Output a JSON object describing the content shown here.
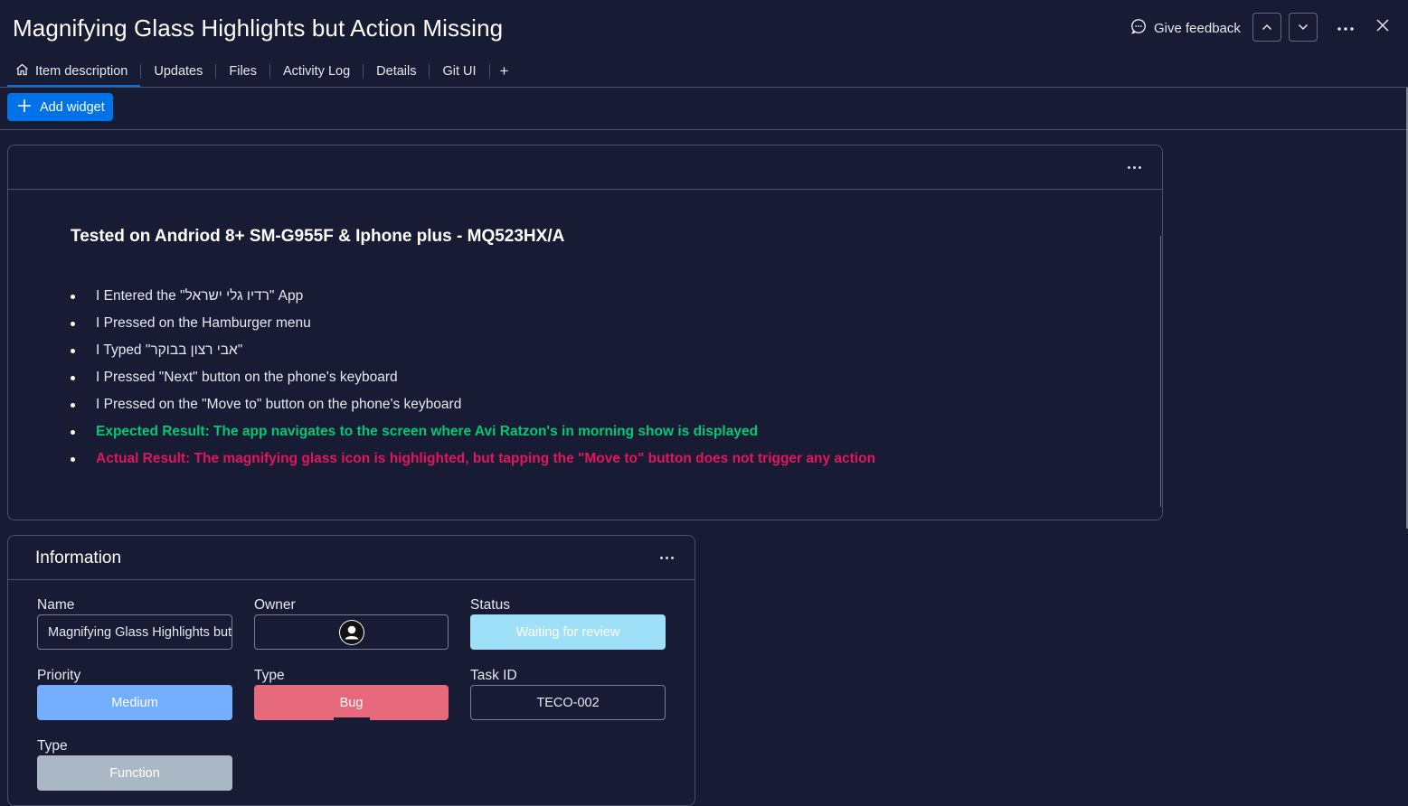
{
  "header": {
    "title": "Magnifying Glass Highlights but Action Missing",
    "feedback_label": "Give feedback",
    "feedback_icon": "chat-feedback-icon",
    "prev_icon": "chevron-up-icon",
    "next_icon": "chevron-down-icon",
    "more_icon": "more-horizontal-icon",
    "close_icon": "close-icon"
  },
  "tabs": [
    {
      "label": "Item description",
      "icon": "home-icon",
      "active": true
    },
    {
      "label": "Updates"
    },
    {
      "label": "Files"
    },
    {
      "label": "Activity Log"
    },
    {
      "label": "Details"
    },
    {
      "label": "Git UI"
    },
    {
      "label": "+"
    }
  ],
  "toolbar": {
    "add_widget_label": "Add widget",
    "add_widget_icon": "plus-icon",
    "accent_color": "#0073ea"
  },
  "description": {
    "heading": "Tested on Andriod 8+ SM-G955F  & Iphone plus - MQ523HX/A",
    "steps": [
      "I Entered the \"רדיו גלי ישראל\" App",
      "I Pressed on the Hamburger menu",
      "I Typed \"אבי רצון בבוקר\"",
      "I Pressed \"Next\" button on the phone's keyboard",
      "I Pressed on the \"Move to\" button on the phone's keyboard"
    ],
    "expected": "Expected Result: The app navigates to the screen where Avi Ratzon's in morning show is displayed",
    "actual": "Actual Result: The magnifying glass icon is highlighted, but tapping the \"Move to\" button does not trigger any action",
    "expected_color": "#00c875",
    "actual_color": "#e2165e"
  },
  "information": {
    "title": "Information",
    "fields": {
      "name": {
        "label": "Name",
        "value": "Magnifying Glass Highlights but Action Missing"
      },
      "owner": {
        "label": "Owner",
        "icon": "person-avatar-icon"
      },
      "status": {
        "label": "Status",
        "value": "Waiting for review",
        "color": "#9ee0f7"
      },
      "priority": {
        "label": "Priority",
        "value": "Medium",
        "color": "#74aeff"
      },
      "type": {
        "label": "Type",
        "value": "Bug",
        "color": "#e76a7c"
      },
      "task_id": {
        "label": "Task ID",
        "value": "TECO-002"
      },
      "type2": {
        "label": "Type",
        "value": "Function",
        "color": "#aab8c6"
      }
    }
  }
}
